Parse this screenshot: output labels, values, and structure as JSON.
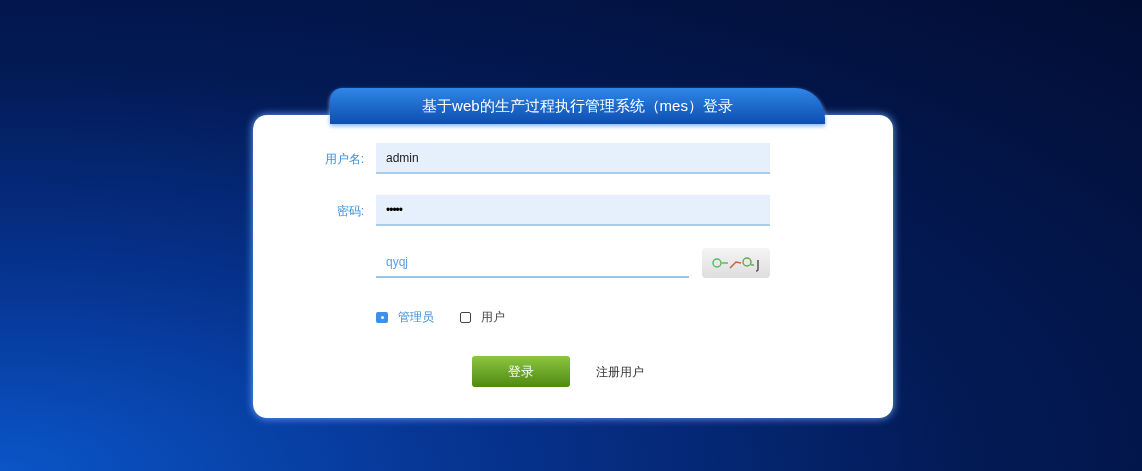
{
  "title": "基于web的生产过程执行管理系统（mes）登录",
  "fields": [
    {
      "label": "用户名:",
      "value": "admin",
      "kind": "text"
    },
    {
      "label": "密码:",
      "value": "•••••",
      "kind": "password"
    }
  ],
  "captcha": {
    "value": "qyqj"
  },
  "roles": [
    {
      "label": "管理员",
      "selected": true
    },
    {
      "label": "用户",
      "selected": false
    }
  ],
  "login_button": "登录",
  "register_link": "注册用户"
}
